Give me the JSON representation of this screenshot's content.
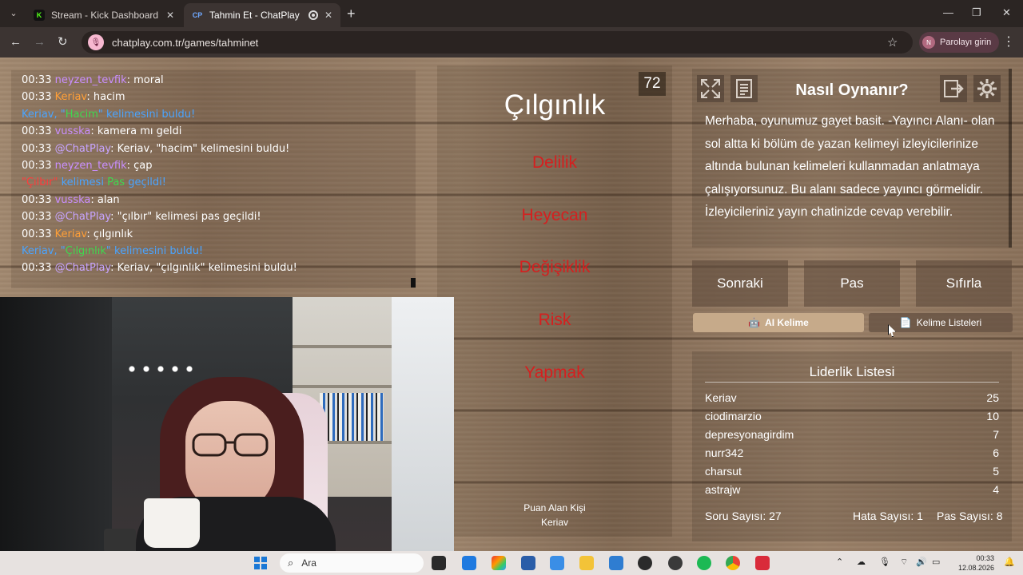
{
  "browser": {
    "tabs": [
      {
        "label": "Stream - Kick Dashboard",
        "favicon": "K"
      },
      {
        "label": "Tahmin Et - ChatPlay",
        "favicon": "CP"
      }
    ],
    "url": "chatplay.com.tr/games/tahminet",
    "profile_label": "Parolayı girin",
    "profile_initial": "N"
  },
  "chat": {
    "lines": [
      {
        "time": "00:33",
        "user": "neyzen_tevfik",
        "text": ": moral"
      },
      {
        "time": "00:33",
        "user": "Keriav",
        "text": ": hacim"
      },
      {
        "sys1": "Keriav, \"",
        "word": "Hacim",
        "sys2": "\" kelimesini buldu!"
      },
      {
        "time": "00:33",
        "user": "vusska",
        "text": ": kamera mı geldi"
      },
      {
        "time": "00:33",
        "user": "@ChatPlay",
        "text": ": Keriav, \"hacim\" kelimesini buldu!"
      },
      {
        "time": "00:33",
        "user": "neyzen_tevfik",
        "text": ": çap"
      },
      {
        "word": "\"Çılbır\"",
        "sys1": " kelimesi ",
        "pas": "Pas",
        "sys2": " geçildi!"
      },
      {
        "time": "00:33",
        "user": "vusska",
        "text": ": alan"
      },
      {
        "time": "00:33",
        "user": "@ChatPlay",
        "text": ": \"çılbır\" kelimesi pas geçildi!"
      },
      {
        "time": "00:33",
        "user": "Keriav",
        "text": ": çılgınlık"
      },
      {
        "sys1": "Keriav, \"",
        "word": "Çılgınlık",
        "sys2": "\" kelimesini buldu!"
      },
      {
        "time": "00:33",
        "user": "@ChatPlay",
        "text": ": Keriav, \"çılgınlık\" kelimesini buldu!"
      }
    ]
  },
  "game": {
    "timer": "72",
    "word": "Çılgınlık",
    "forbidden": [
      "Delilik",
      "Heyecan",
      "Değişiklik",
      "Risk",
      "Yapmak"
    ],
    "scorer_label": "Puan Alan Kişi",
    "scorer_name": "Keriav"
  },
  "rules": {
    "title": "Nasıl Oynanır?",
    "text": "Merhaba, oyunumuz gayet basit. -Yayıncı Alanı- olan sol altta ki bölüm de yazan kelimeyi izleyicilerinize altında bulunan kelimeleri kullanmadan anlatmaya çalışıyorsunuz. Bu alanı sadece yayıncı görmelidir. İzleyicileriniz yayın chatinizde cevap verebilir."
  },
  "controls": {
    "next": "Sonraki",
    "pass": "Pas",
    "reset": "Sıfırla",
    "ai_word": "AI Kelime",
    "word_lists": "Kelime Listeleri"
  },
  "leaderboard": {
    "title": "Liderlik Listesi",
    "rows": [
      {
        "name": "Keriav",
        "score": "25"
      },
      {
        "name": "ciodimarzio",
        "score": "10"
      },
      {
        "name": "depresyonagirdim",
        "score": "7"
      },
      {
        "name": "nurr342",
        "score": "6"
      },
      {
        "name": "charsut",
        "score": "5"
      },
      {
        "name": "astrajw",
        "score": "4"
      }
    ],
    "questions": "Soru Sayısı: 27",
    "errors": "Hata Sayısı: 1",
    "passes": "Pas Sayısı: 8"
  },
  "taskbar": {
    "search_placeholder": "Ara",
    "time": "00:33",
    "date": "12.08.2026"
  }
}
